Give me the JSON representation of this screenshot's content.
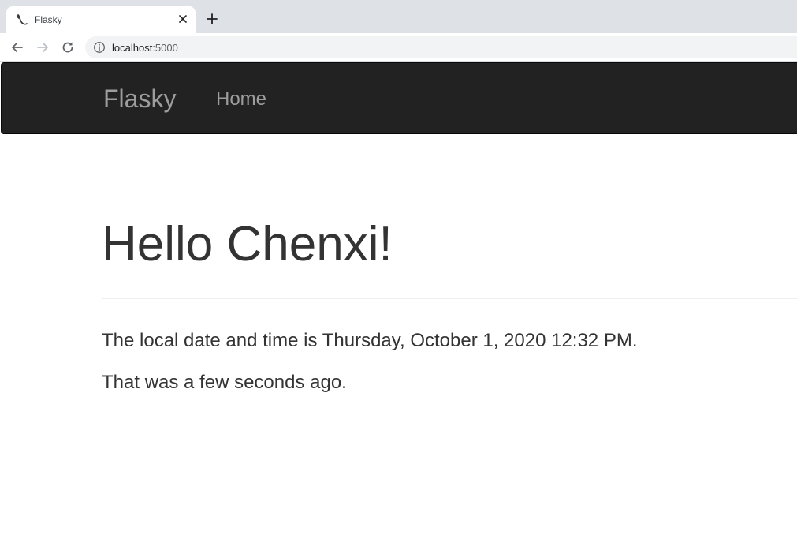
{
  "browser": {
    "tab": {
      "title": "Flasky",
      "favicon": "flask-horn-icon"
    },
    "new_tab_icon": "plus-icon",
    "close_icon": "close-icon",
    "address": {
      "host": "localhost",
      "port": ":5000"
    },
    "nav_icons": [
      "back-arrow-icon",
      "forward-arrow-icon",
      "reload-icon",
      "info-icon"
    ]
  },
  "navbar": {
    "brand": "Flasky",
    "links": [
      {
        "label": "Home"
      }
    ],
    "background": "#222222",
    "text_color": "#9d9d9d"
  },
  "main": {
    "heading": "Hello Chenxi!",
    "datetime_text": "The local date and time is Thursday, October 1, 2020 12:32 PM.",
    "relative_text": "That was a few seconds ago."
  }
}
